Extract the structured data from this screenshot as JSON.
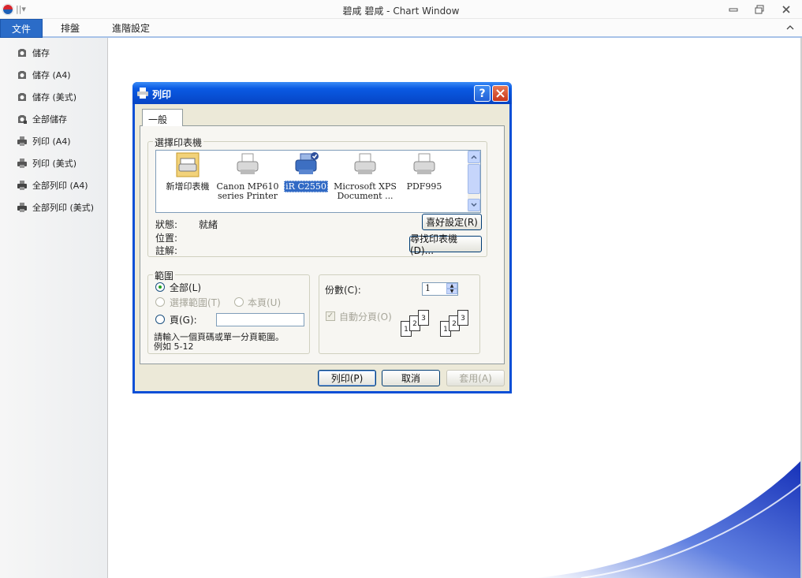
{
  "window": {
    "title": "碧咸 碧咸 - Chart Window",
    "qa_separator": "||▾"
  },
  "ribbon": {
    "tabs": [
      {
        "label": "文件",
        "active": true
      },
      {
        "label": "排盤",
        "active": false
      },
      {
        "label": "進階設定",
        "active": false
      }
    ]
  },
  "sidebar": {
    "items": [
      {
        "label": "儲存",
        "icon": "save-icon"
      },
      {
        "label": "儲存 (A4)",
        "icon": "save-icon"
      },
      {
        "label": "儲存 (美式)",
        "icon": "save-icon"
      },
      {
        "label": "全部儲存",
        "icon": "save-all-icon"
      },
      {
        "label": "列印 (A4)",
        "icon": "printer-icon"
      },
      {
        "label": "列印 (美式)",
        "icon": "printer-icon"
      },
      {
        "label": "全部列印 (A4)",
        "icon": "print-all-icon"
      },
      {
        "label": "全部列印 (美式)",
        "icon": "print-all-icon"
      }
    ]
  },
  "dialog": {
    "title": "列印",
    "tab": "一般",
    "select_printer": {
      "group_label": "選擇印表機",
      "printers": [
        {
          "label": "新增印表機",
          "icon": "add-printer-icon",
          "selected": false
        },
        {
          "label": "Canon MP610 series Printer",
          "line1": "Canon MP610",
          "line2": "series Printer",
          "icon": "printer-icon",
          "selected": false
        },
        {
          "label": "iR C2550",
          "icon": "network-printer-icon",
          "selected": true
        },
        {
          "label": "Microsoft XPS Document ...",
          "line1": "Microsoft XPS",
          "line2": "Document ...",
          "icon": "printer-icon",
          "selected": false
        },
        {
          "label": "PDF995",
          "icon": "printer-icon",
          "selected": false
        }
      ],
      "status_label": "狀態:",
      "status_value": "就緒",
      "location_label": "位置:",
      "comment_label": "註解:",
      "preferences_button": "喜好設定(R)",
      "find_printer_button": "尋找印表機(D)..."
    },
    "range": {
      "group_label": "範圍",
      "all": "全部(L)",
      "selection": "選擇範圍(T)",
      "current_page": "本頁(U)",
      "pages": "頁(G):",
      "pages_value": "",
      "hint_line1": "請輸入一個頁碼或單一分頁範圍。",
      "hint_line2": "例如 5-12"
    },
    "copies": {
      "label": "份數(C):",
      "value": "1",
      "collate": "自動分頁(O)",
      "collate_checked": true
    },
    "buttons": {
      "print": "列印(P)",
      "cancel": "取消",
      "apply": "套用(A)"
    }
  }
}
